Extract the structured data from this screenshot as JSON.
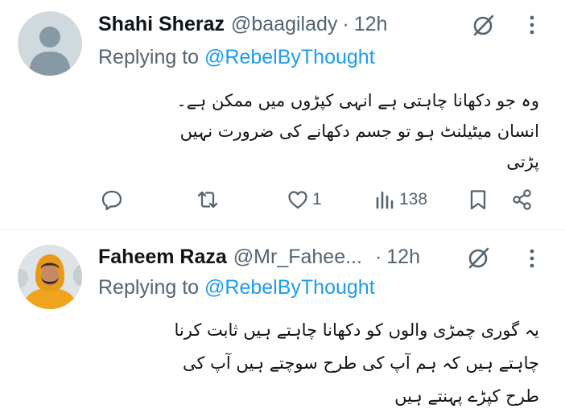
{
  "tweets": [
    {
      "author_name": "Shahi Sheraz",
      "handle": "@baagilady",
      "separator": "·",
      "time": "12h",
      "replying_prefix": "Replying to",
      "replying_mention": "@RebelByThought",
      "lines": [
        "وہ جو دکھانا چاہتی ہے انہی کپڑوں میں ممکن ہے۔",
        "انسان میٹیلنٹ ہو تو جسم دکھانے کی ضرورت نہیں",
        "پڑتی"
      ],
      "actions": {
        "reply_icon": "reply-icon",
        "repost_icon": "repost-icon",
        "like_icon": "heart-icon",
        "likes": "1",
        "views_icon": "views-icon",
        "views": "138",
        "bookmark_icon": "bookmark-icon",
        "share_icon": "share-icon"
      }
    },
    {
      "author_name": "Faheem Raza",
      "handle": "@Mr_Fahee...",
      "separator": "·",
      "time": "12h",
      "replying_prefix": "Replying to",
      "replying_mention": "@RebelByThought",
      "lines": [
        "یہ گوری چمڑی والوں کو دکھانا چاہتے ہیں ثابت کرنا",
        "چاہتے ہیں کہ ہم آپ کی طرح سوچتے ہیں آپ کی",
        "طرح کپڑے پہنتے ہیں"
      ]
    }
  ],
  "colors": {
    "text": "#0f1419",
    "secondary": "#536471",
    "link": "#1d9bf0",
    "divider": "#eff3f4"
  }
}
